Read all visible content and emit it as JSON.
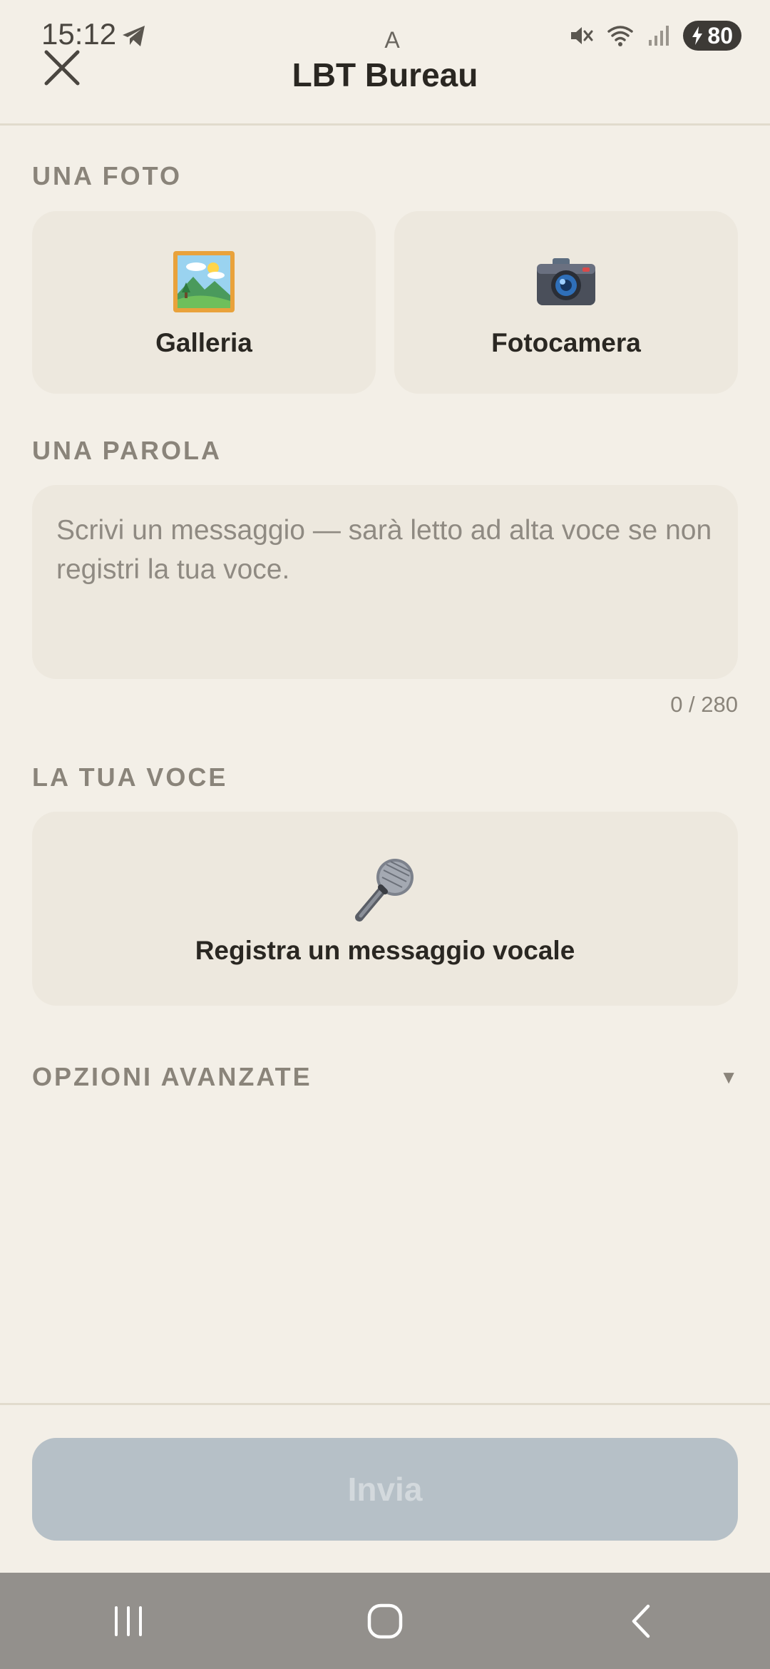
{
  "status_bar": {
    "time": "15:12",
    "carrier_label": "A",
    "battery_level": "80",
    "icons": [
      "telegram-icon",
      "vibrate-mute-icon",
      "wifi-icon",
      "signal-icon",
      "battery-charging-icon"
    ]
  },
  "header": {
    "title": "LBT Bureau",
    "close_icon": "close-icon"
  },
  "photo_section": {
    "label": "UNA FOTO",
    "gallery": {
      "label": "Galleria",
      "icon": "gallery-picture-icon"
    },
    "camera": {
      "label": "Fotocamera",
      "icon": "camera-icon"
    }
  },
  "word_section": {
    "label": "UNA PAROLA",
    "message_value": "",
    "message_placeholder": "Scrivi un messaggio — sarà letto ad alta voce se non registri la tua voce.",
    "char_counter": "0 / 280"
  },
  "voice_section": {
    "label": "LA TUA VOCE",
    "record_label": "Registra un messaggio vocale",
    "icon": "microphone-icon"
  },
  "advanced_options": {
    "label": "OPZIONI AVANZATE",
    "chevron": "▼"
  },
  "footer": {
    "send_label": "Invia",
    "send_enabled": false
  },
  "colors": {
    "background": "#f3efe7",
    "card": "#ede8de",
    "section_label": "#8a847a",
    "send_disabled_bg": "#b6c0c7",
    "send_disabled_text": "#d3d9dd",
    "nav_bar": "#93908c"
  },
  "nav_bar": {
    "buttons": [
      "recent-apps-icon",
      "home-icon",
      "back-icon"
    ]
  }
}
